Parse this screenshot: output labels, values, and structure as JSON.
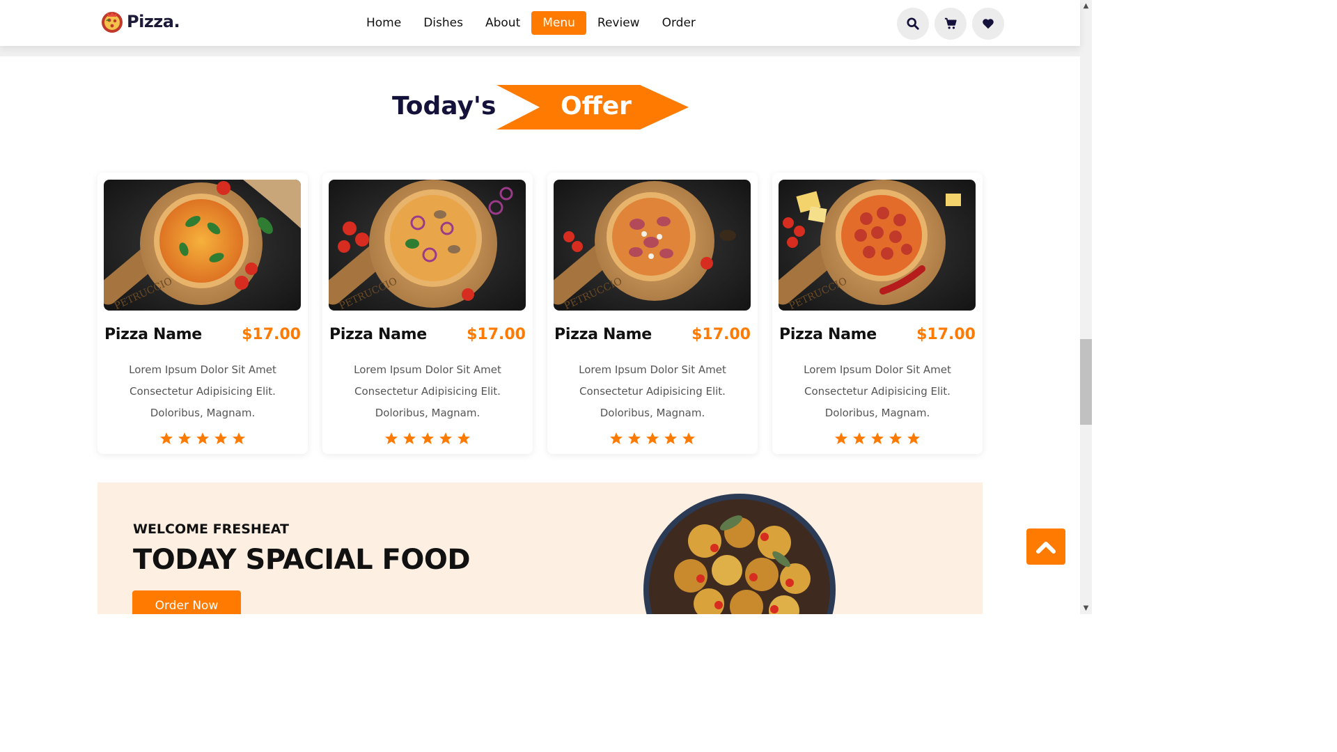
{
  "header": {
    "logo_text": "Pizza.",
    "nav": [
      {
        "label": "Home",
        "active": false
      },
      {
        "label": "Dishes",
        "active": false
      },
      {
        "label": "About",
        "active": false
      },
      {
        "label": "Menu",
        "active": true
      },
      {
        "label": "Review",
        "active": false
      },
      {
        "label": "Order",
        "active": false
      }
    ],
    "icons": [
      "search-icon",
      "cart-icon",
      "heart-icon"
    ]
  },
  "section": {
    "title_part1": "Today's",
    "title_part2": "Offer"
  },
  "cards": [
    {
      "name": "Pizza Name",
      "price": "$17.00",
      "desc_line1": "Lorem Ipsum Dolor Sit Amet",
      "desc_line2": "Consectetur Adipisicing Elit.",
      "desc_line3": "Doloribus, Magnam.",
      "rating": 5
    },
    {
      "name": "Pizza Name",
      "price": "$17.00",
      "desc_line1": "Lorem Ipsum Dolor Sit Amet",
      "desc_line2": "Consectetur Adipisicing Elit.",
      "desc_line3": "Doloribus, Magnam.",
      "rating": 5
    },
    {
      "name": "Pizza Name",
      "price": "$17.00",
      "desc_line1": "Lorem Ipsum Dolor Sit Amet",
      "desc_line2": "Consectetur Adipisicing Elit.",
      "desc_line3": "Doloribus, Magnam.",
      "rating": 5
    },
    {
      "name": "Pizza Name",
      "price": "$17.00",
      "desc_line1": "Lorem Ipsum Dolor Sit Amet",
      "desc_line2": "Consectetur Adipisicing Elit.",
      "desc_line3": "Doloribus, Magnam.",
      "rating": 5
    }
  ],
  "board_text": "PETRUCCIO",
  "promo": {
    "welcome": "WELCOME FRESHEAT",
    "title": "TODAY SPACIAL FOOD",
    "button": "Order Now"
  },
  "colors": {
    "accent": "#ff7a00",
    "dark_navy": "#14123a",
    "promo_bg": "#fdf0e3"
  }
}
